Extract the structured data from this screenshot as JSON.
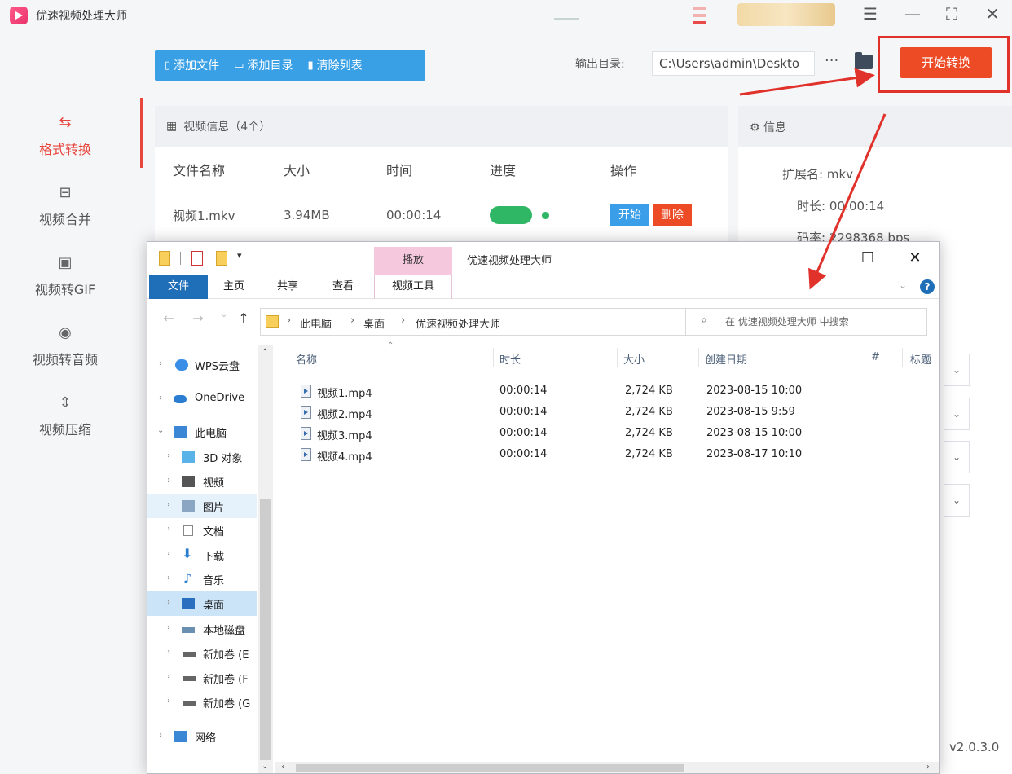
{
  "app": {
    "title": "优速视频处理大师",
    "version": "v2.0.3.0",
    "controls": [
      "☰",
      "—",
      "⛶",
      "✕"
    ],
    "accent": "#e8453c",
    "blue": "#3aa0e6",
    "start_color": "#ec4b26"
  },
  "sidebar": {
    "items": [
      {
        "label": "格式转换",
        "icon": "format-convert-icon",
        "glyph": "⇆",
        "active": true
      },
      {
        "label": "视频合并",
        "icon": "video-merge-icon",
        "glyph": "⊟",
        "active": false
      },
      {
        "label": "视频转GIF",
        "icon": "gif-icon",
        "glyph": "▣",
        "active": false
      },
      {
        "label": "视频转音频",
        "icon": "audio-icon",
        "glyph": "◉",
        "active": false
      },
      {
        "label": "视频压缩",
        "icon": "compress-icon",
        "glyph": "⇕",
        "active": false
      }
    ]
  },
  "toolbar": {
    "add_file": "添加文件",
    "add_dir": "添加目录",
    "clear_list": "清除列表",
    "output_label": "输出目录:",
    "output_path": "C:\\Users\\admin\\Deskto",
    "more": "···",
    "start": "开始转换"
  },
  "video_panel": {
    "header": "视频信息（4个）",
    "columns": [
      "文件名称",
      "大小",
      "时间",
      "进度",
      "操作"
    ],
    "rows": [
      {
        "name": "视频1.mkv",
        "size": "3.94MB",
        "time": "00:00:14",
        "progress": 1.0,
        "op_start": "开始",
        "op_delete": "删除"
      }
    ]
  },
  "info_panel": {
    "header": "信息",
    "rows": [
      {
        "key": "扩展名:",
        "value": "mkv"
      },
      {
        "key": "时长:",
        "value": "00:00:14"
      },
      {
        "key": "码率:",
        "value": "2298368 bps"
      }
    ]
  },
  "explorer": {
    "title": "优速视频处理大师",
    "context_tab": "播放",
    "context_tool": "视频工具",
    "ribbon_tabs": [
      "文件",
      "主页",
      "共享",
      "查看"
    ],
    "breadcrumbs": [
      "此电脑",
      "桌面",
      "优速视频处理大师"
    ],
    "search_placeholder": "在 优速视频处理大师 中搜索",
    "nav": [
      {
        "label": "WPS云盘",
        "icon": "cloud-icon",
        "state": ""
      },
      {
        "label": "OneDrive",
        "icon": "onedrive-icon",
        "state": ""
      },
      {
        "label": "此电脑",
        "icon": "computer-icon",
        "state": "expanded"
      },
      {
        "label": "3D 对象",
        "icon": "3d-objects-icon",
        "state": ""
      },
      {
        "label": "视频",
        "icon": "videos-folder-icon",
        "state": ""
      },
      {
        "label": "图片",
        "icon": "pictures-folder-icon",
        "state": "hover"
      },
      {
        "label": "文档",
        "icon": "documents-folder-icon",
        "state": ""
      },
      {
        "label": "下载",
        "icon": "downloads-folder-icon",
        "state": ""
      },
      {
        "label": "音乐",
        "icon": "music-folder-icon",
        "state": ""
      },
      {
        "label": "桌面",
        "icon": "desktop-folder-icon",
        "state": "selected"
      },
      {
        "label": "本地磁盘",
        "icon": "local-disk-icon",
        "state": ""
      },
      {
        "label": "新加卷 (E",
        "icon": "drive-icon",
        "state": ""
      },
      {
        "label": "新加卷 (F",
        "icon": "drive-icon",
        "state": ""
      },
      {
        "label": "新加卷 (G",
        "icon": "drive-icon",
        "state": ""
      },
      {
        "label": "网络",
        "icon": "network-icon",
        "state": ""
      }
    ],
    "columns": [
      "名称",
      "时长",
      "大小",
      "创建日期",
      "#",
      "标题"
    ],
    "files": [
      {
        "name": "视频1.mp4",
        "duration": "00:00:14",
        "size": "2,724 KB",
        "created": "2023-08-15 10:00"
      },
      {
        "name": "视频2.mp4",
        "duration": "00:00:14",
        "size": "2,724 KB",
        "created": "2023-08-15 9:59"
      },
      {
        "name": "视频3.mp4",
        "duration": "00:00:14",
        "size": "2,724 KB",
        "created": "2023-08-15 10:00"
      },
      {
        "name": "视频4.mp4",
        "duration": "00:00:14",
        "size": "2,724 KB",
        "created": "2023-08-17 10:10"
      }
    ]
  }
}
